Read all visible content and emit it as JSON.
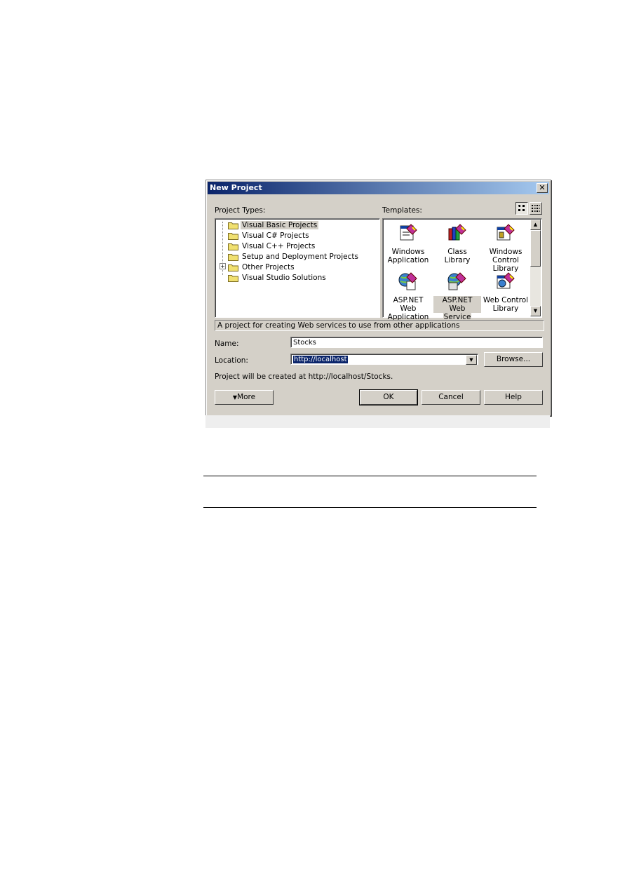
{
  "dialog": {
    "title": "New Project",
    "close_glyph": "✕",
    "project_types_label": "Project Types:",
    "templates_label": "Templates:",
    "project_types": [
      {
        "label": "Visual Basic Projects",
        "selected": true
      },
      {
        "label": "Visual C# Projects",
        "selected": false
      },
      {
        "label": "Visual C++ Projects",
        "selected": false
      },
      {
        "label": "Setup and Deployment Projects",
        "selected": false
      },
      {
        "label": "Other Projects",
        "selected": false,
        "expandable": true
      },
      {
        "label": "Visual Studio Solutions",
        "selected": false
      }
    ],
    "templates": [
      {
        "line1": "Windows",
        "line2": "Application",
        "icon": "windows-application-icon"
      },
      {
        "line1": "Class Library",
        "line2": "",
        "icon": "class-library-icon"
      },
      {
        "line1": "Windows",
        "line2": "Control Library",
        "icon": "windows-control-library-icon"
      },
      {
        "line1": "ASP.NET Web",
        "line2": "Application",
        "icon": "aspnet-web-application-icon"
      },
      {
        "line1": "ASP.NET Web",
        "line2": "Service",
        "icon": "aspnet-web-service-icon",
        "selected": true
      },
      {
        "line1": "Web Control",
        "line2": "Library",
        "icon": "web-control-library-icon"
      }
    ],
    "description": "A project for creating Web services to use from other applications",
    "name_label": "Name:",
    "name_value": "Stocks",
    "location_label": "Location:",
    "location_value": "http://localhost",
    "browse_label": "Browse...",
    "created_at_text": "Project will be created at http://localhost/Stocks.",
    "more_label": "More",
    "more_glyph": "▼",
    "ok_label": "OK",
    "cancel_label": "Cancel",
    "help_label": "Help"
  },
  "colors": {
    "dialog_face": "#d4d0c8",
    "title_start": "#0a246a",
    "title_end": "#a6caf0",
    "selection": "#0a246a"
  }
}
